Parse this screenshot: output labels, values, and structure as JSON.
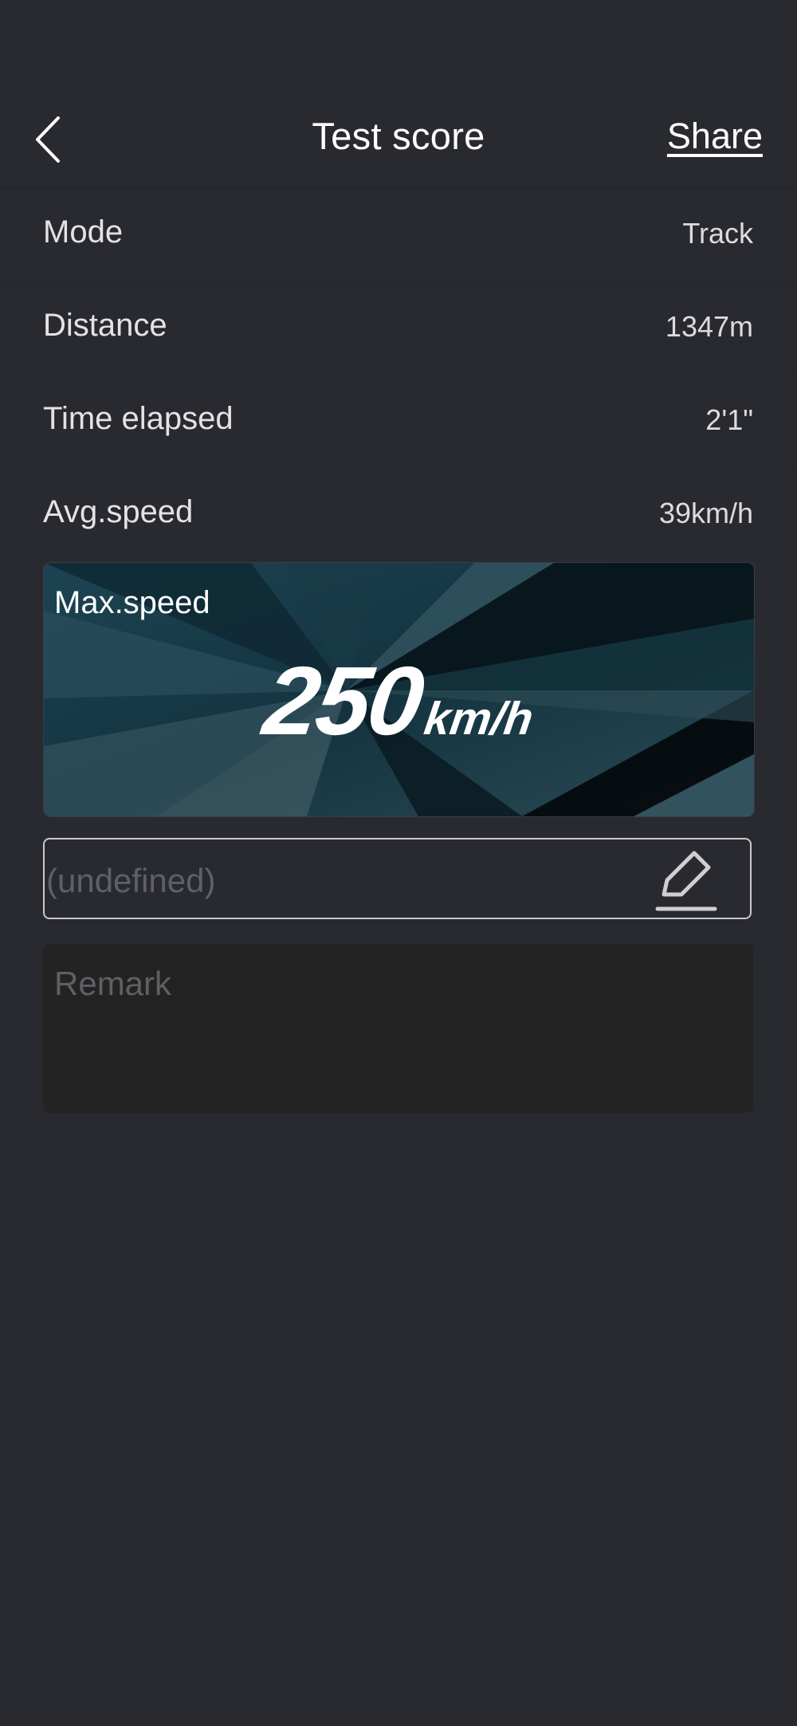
{
  "header": {
    "back_icon": "chevron-left-icon",
    "title": "Test score",
    "share_label": "Share"
  },
  "stats": [
    {
      "label": "Mode",
      "value": "Track"
    },
    {
      "label": "Distance",
      "value": "1347m"
    },
    {
      "label": "Time elapsed",
      "value": "2'1\""
    },
    {
      "label": "Avg.speed",
      "value": "39km/h"
    }
  ],
  "max_speed": {
    "label": "Max.speed",
    "value": "250",
    "unit": "km/h"
  },
  "name_input": {
    "placeholder": "(undefined)",
    "edit_icon": "pencil-edit-icon"
  },
  "remark": {
    "placeholder": "Remark"
  },
  "colors": {
    "background": "#292a30",
    "banner": "#16323d",
    "text": "#ffffff",
    "placeholder": "#5f6066"
  }
}
